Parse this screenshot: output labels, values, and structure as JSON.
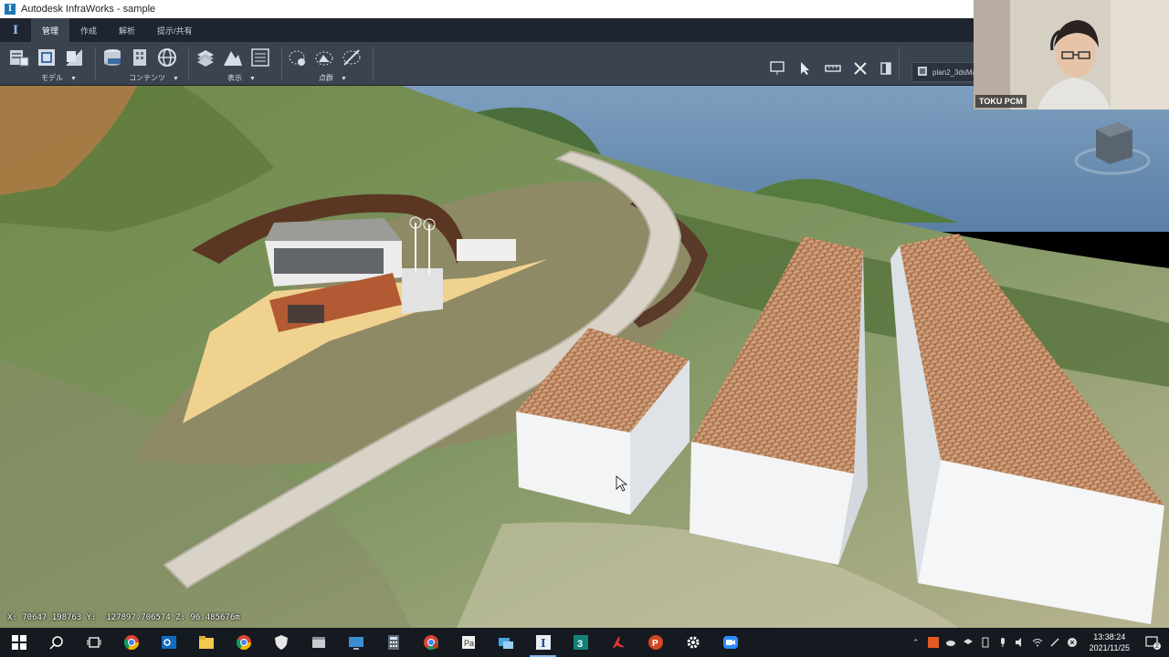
{
  "window": {
    "title": "Autodesk InfraWorks - sample"
  },
  "ribbon": {
    "logo": "I",
    "tabs": [
      "管理",
      "作成",
      "解析",
      "提示/共有"
    ],
    "active_tab": 0,
    "groups": [
      {
        "label": "モデル",
        "icons": [
          "model-properties-icon",
          "data-sources-icon",
          "style-palette-icon"
        ]
      },
      {
        "label": "コンテンツ",
        "icons": [
          "database-icon",
          "building-icon",
          "globe-icon"
        ]
      },
      {
        "label": "表示",
        "icons": [
          "layers-icon",
          "terrain-icon",
          "list-icon"
        ]
      },
      {
        "label": "点群",
        "icons": [
          "point-cloud-icon",
          "cloud-terrain-icon",
          "cloud-clip-icon"
        ]
      }
    ],
    "right_tools": [
      "presentation-icon",
      "select-pointer-icon",
      "measure-icon",
      "close-tool-icon",
      "panel-icon"
    ],
    "layer_box": "plan2_3dsMax"
  },
  "viewport": {
    "coordinates": "X: 70647.198763 Y: -127897.706574 Z: 96.485676m"
  },
  "webcam": {
    "name": "TOKU PCM"
  },
  "taskbar": {
    "apps": [
      {
        "icon": "windows-start-icon",
        "active": false
      },
      {
        "icon": "search-icon",
        "active": false
      },
      {
        "icon": "task-view-icon",
        "active": false
      },
      {
        "icon": "chrome-icon",
        "active": false
      },
      {
        "icon": "outlook-icon",
        "active": false
      },
      {
        "icon": "file-explorer-icon",
        "active": false
      },
      {
        "icon": "chrome-alt-icon",
        "active": false
      },
      {
        "icon": "shield-app-icon",
        "active": false
      },
      {
        "icon": "window-app-icon",
        "active": false
      },
      {
        "icon": "remote-desktop-icon",
        "active": false
      },
      {
        "icon": "calculator-icon",
        "active": false
      },
      {
        "icon": "chrome-badge-icon",
        "active": false
      },
      {
        "icon": "publisher-icon",
        "active": false
      },
      {
        "icon": "network-app-icon",
        "active": false
      },
      {
        "icon": "infraworks-icon",
        "active": true
      },
      {
        "icon": "3dsmax-icon",
        "active": false
      },
      {
        "icon": "acrobat-icon",
        "active": false
      },
      {
        "icon": "powerpoint-icon",
        "active": false
      },
      {
        "icon": "settings-gear-icon",
        "active": false
      },
      {
        "icon": "zoom-icon",
        "active": false
      }
    ],
    "clock_time": "13:38:24",
    "clock_date": "2021/11/25",
    "notification_count": "2"
  }
}
